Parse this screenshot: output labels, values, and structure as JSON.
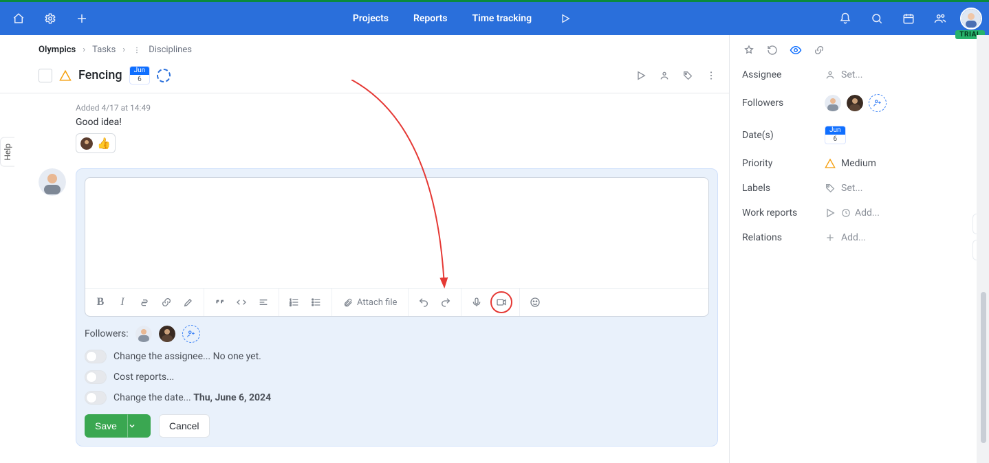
{
  "topbar": {
    "tabs": {
      "projects": "Projects",
      "reports": "Reports",
      "time": "Time tracking"
    },
    "trial": "TRIAL"
  },
  "help_tab": "Help",
  "breadcrumb": {
    "root": "Olympics",
    "section": "Tasks",
    "current": "Disciplines"
  },
  "task": {
    "title": "Fencing",
    "date_month": "Jun",
    "date_day": "6"
  },
  "comment": {
    "meta": "Added 4/17 at 14:49",
    "text": "Good idea!",
    "reaction_emoji": "👍"
  },
  "composer": {
    "attach_label": "Attach file",
    "followers_label": "Followers:",
    "toggle1_prefix": "Change the assignee... ",
    "toggle1_value": "No one yet.",
    "toggle2_label": "Cost reports...",
    "toggle3_prefix": "Change the date... ",
    "toggle3_value": "Thu, June 6, 2024",
    "save": "Save",
    "cancel": "Cancel"
  },
  "side": {
    "labels": {
      "assignee": "Assignee",
      "followers": "Followers",
      "dates": "Date(s)",
      "priority": "Priority",
      "labels": "Labels",
      "workreports": "Work reports",
      "relations": "Relations"
    },
    "values": {
      "assignee": "Set...",
      "date_month": "Jun",
      "date_day": "6",
      "priority": "Medium",
      "labels": "Set...",
      "workreports": "Add...",
      "relations": "Add..."
    }
  },
  "icons": {
    "home": "home-icon",
    "gear": "gear-icon",
    "plus": "plus-icon",
    "play": "play-icon",
    "bell": "bell-icon",
    "search": "search-icon",
    "calendar": "calendar-icon",
    "people": "people-icon"
  },
  "colors": {
    "accent": "#2a6fdb",
    "success": "#3aa751",
    "annotation": "#e53935",
    "priority": "#f59e0b"
  }
}
